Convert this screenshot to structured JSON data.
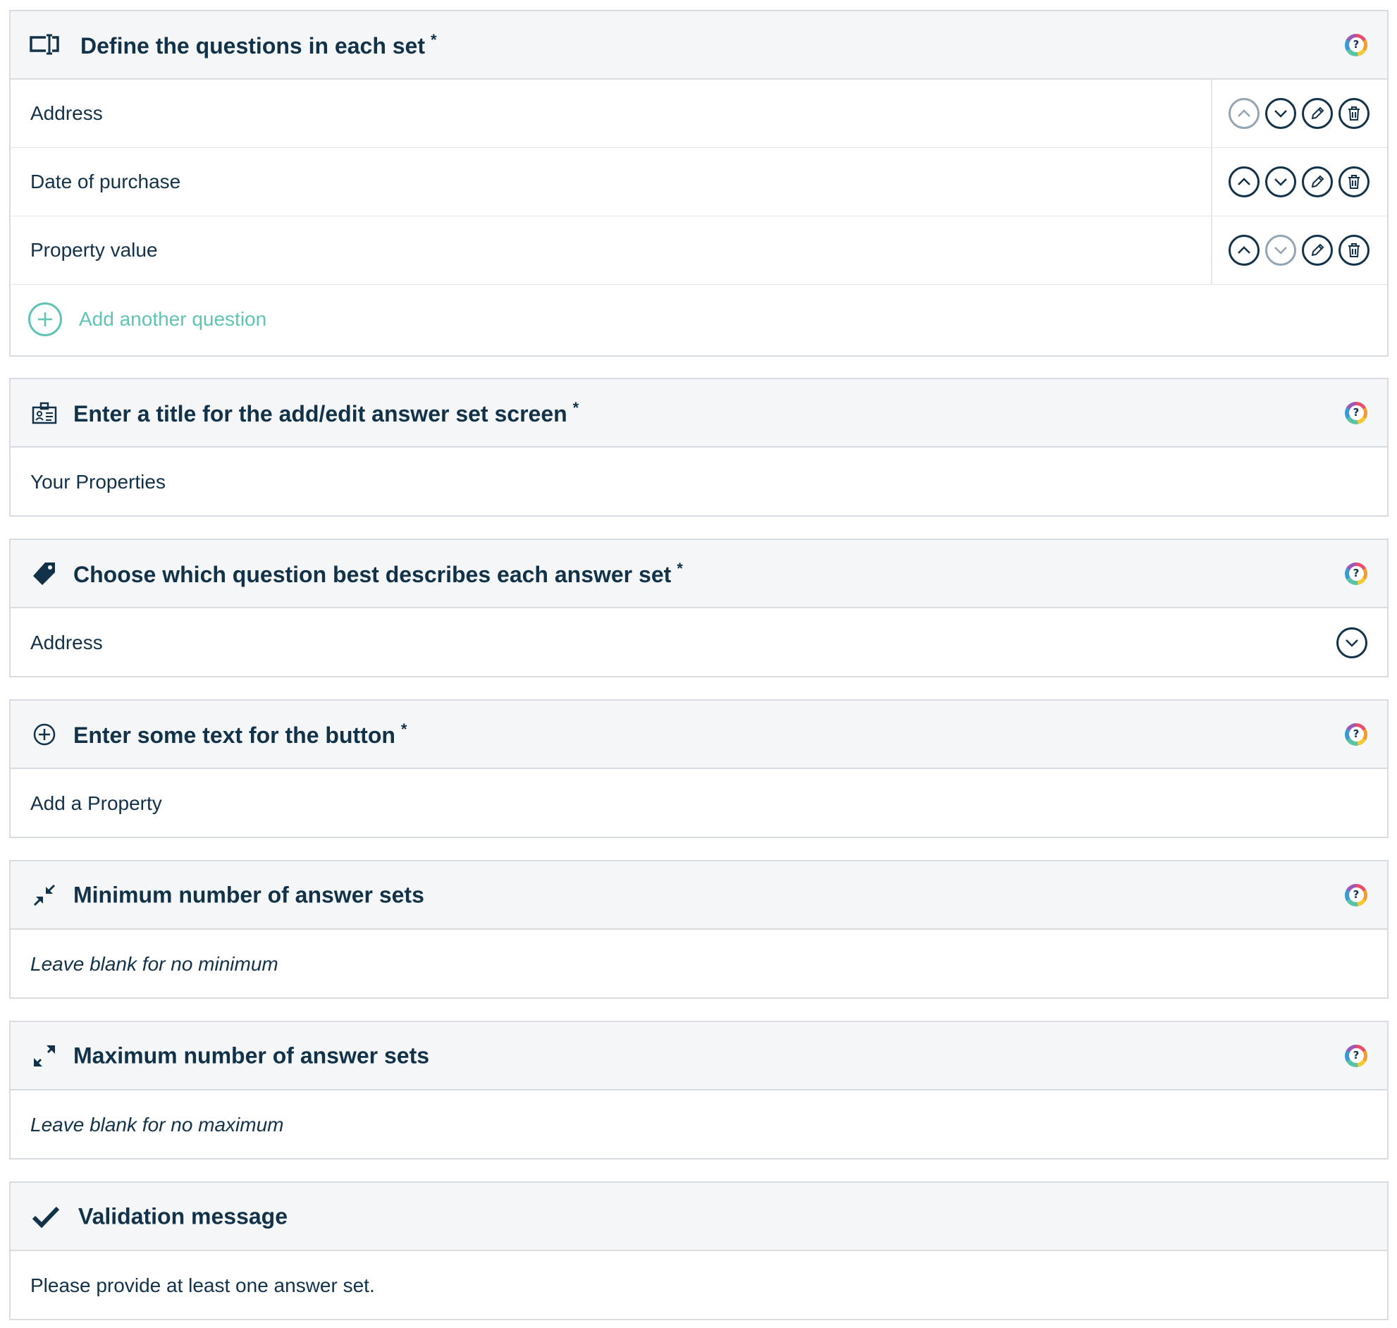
{
  "questions_panel": {
    "title": "Define the questions in each set",
    "required_mark": "*",
    "questions": [
      {
        "label": "Address"
      },
      {
        "label": "Date of purchase"
      },
      {
        "label": "Property value"
      }
    ],
    "add_label": "Add another question"
  },
  "title_panel": {
    "title": "Enter a title for the add/edit answer set screen",
    "required_mark": "*",
    "value": "Your Properties"
  },
  "describe_panel": {
    "title": "Choose which question best describes each answer set",
    "required_mark": "*",
    "selected": "Address"
  },
  "button_panel": {
    "title": "Enter some text for the button",
    "required_mark": "*",
    "value": "Add a Property"
  },
  "min_panel": {
    "title": "Minimum number of answer sets",
    "placeholder": "Leave blank for no minimum"
  },
  "max_panel": {
    "title": "Maximum number of answer sets",
    "placeholder": "Leave blank for no maximum"
  },
  "validation_panel": {
    "title": "Validation message",
    "value": "Please provide at least one answer set."
  },
  "help_badge_text": "?",
  "colors": {
    "text": "#123249",
    "accent_teal": "#5fc4b3",
    "header_bg": "#f5f6f8",
    "border": "#d9dde2",
    "disabled": "#93a4b3"
  }
}
